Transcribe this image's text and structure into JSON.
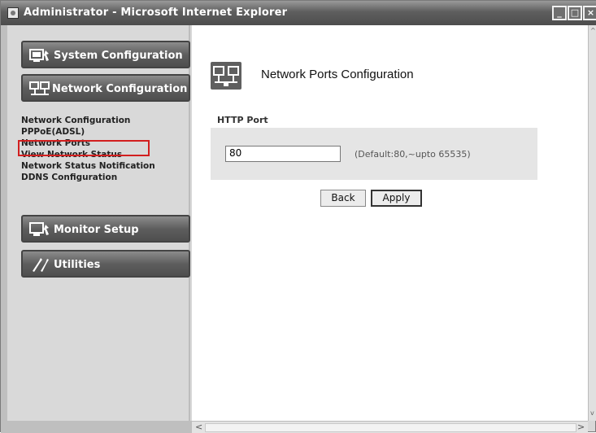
{
  "window": {
    "title": "Administrator - Microsoft Internet Explorer",
    "controls": [
      "_",
      "□",
      "×"
    ]
  },
  "sidebar": {
    "system_configuration": "System Configuration",
    "network_configuration": "Network Configuration",
    "submenu": [
      "Network Configuration",
      "PPPoE(ADSL)",
      "Network Ports",
      "View Network Status",
      "Network Status Notification",
      "DDNS Configuration"
    ],
    "selected_item": "Network Ports",
    "monitor_setup": "Monitor Setup",
    "utilities": "Utilities"
  },
  "main": {
    "title": "Network Ports Configuration",
    "section_label": "HTTP Port",
    "port_value": "80",
    "port_hint": "(Default:80,~upto 65535)",
    "back_label": "Back",
    "apply_label": "Apply"
  },
  "scrollbar": {
    "left_arrow": "<",
    "right_arrow": ">",
    "up_arrow": "^",
    "down_arrow": "v"
  },
  "colors": {
    "highlight_border": "#d21f1f",
    "nav_button": "#5e5e5e",
    "panel_bg": "#e5e5e5"
  }
}
